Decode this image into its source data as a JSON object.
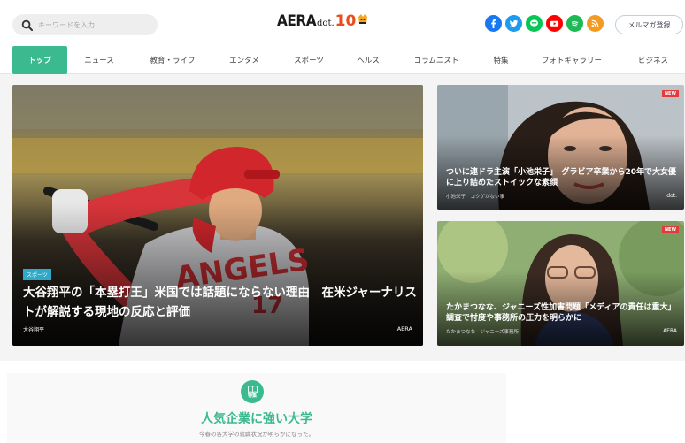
{
  "header": {
    "search_placeholder": "キーワードを入力",
    "logo": {
      "main": "AERA",
      "sub": "dot.",
      "anniversary": "10"
    },
    "social": [
      "facebook-icon",
      "twitter-icon",
      "line-icon",
      "youtube-icon",
      "spotify-icon",
      "rss-icon"
    ],
    "mailmag_label": "メルマガ登録"
  },
  "nav": {
    "tabs": [
      "トップ",
      "ニュース",
      "教育・ライフ",
      "エンタメ",
      "スポーツ",
      "ヘルス",
      "コラムニスト",
      "特集",
      "フォトギャラリー",
      "ビジネス"
    ],
    "active": "トップ"
  },
  "hero": {
    "tag": "スポーツ",
    "title": "大谷翔平の「本塁打王」米国では話題にならない理由　在米ジャーナリストが解説する現地の反応と評価",
    "author": "大谷翔平",
    "source": "AERA"
  },
  "side_articles": [
    {
      "badge": "NEW",
      "title": "ついに連ドラ主演「小池栄子」　グラビア卒業から20年で大女優に上り詰めたストイックな素顔",
      "meta": "小池栄子　コクゲがない事",
      "source": "dot."
    },
    {
      "badge": "NEW",
      "title": "たかまつなな、ジャニーズ性加害問題「メディアの責任は重大」　調査で忖度や事務所の圧力を明らかに",
      "meta": "たかまつなな　ジャニーズ事務所",
      "source": "AERA"
    }
  ],
  "feature": {
    "icon_label": "特集",
    "title": "人気企業に強い大学",
    "subtitle": "今春の各大学の就職状況が明らかになった。"
  },
  "colors": {
    "accent": "#3cba8f",
    "new_badge": "#e13b3b",
    "sport_tag": "#2fa8c9",
    "logo_ten": "#e94d1b"
  }
}
